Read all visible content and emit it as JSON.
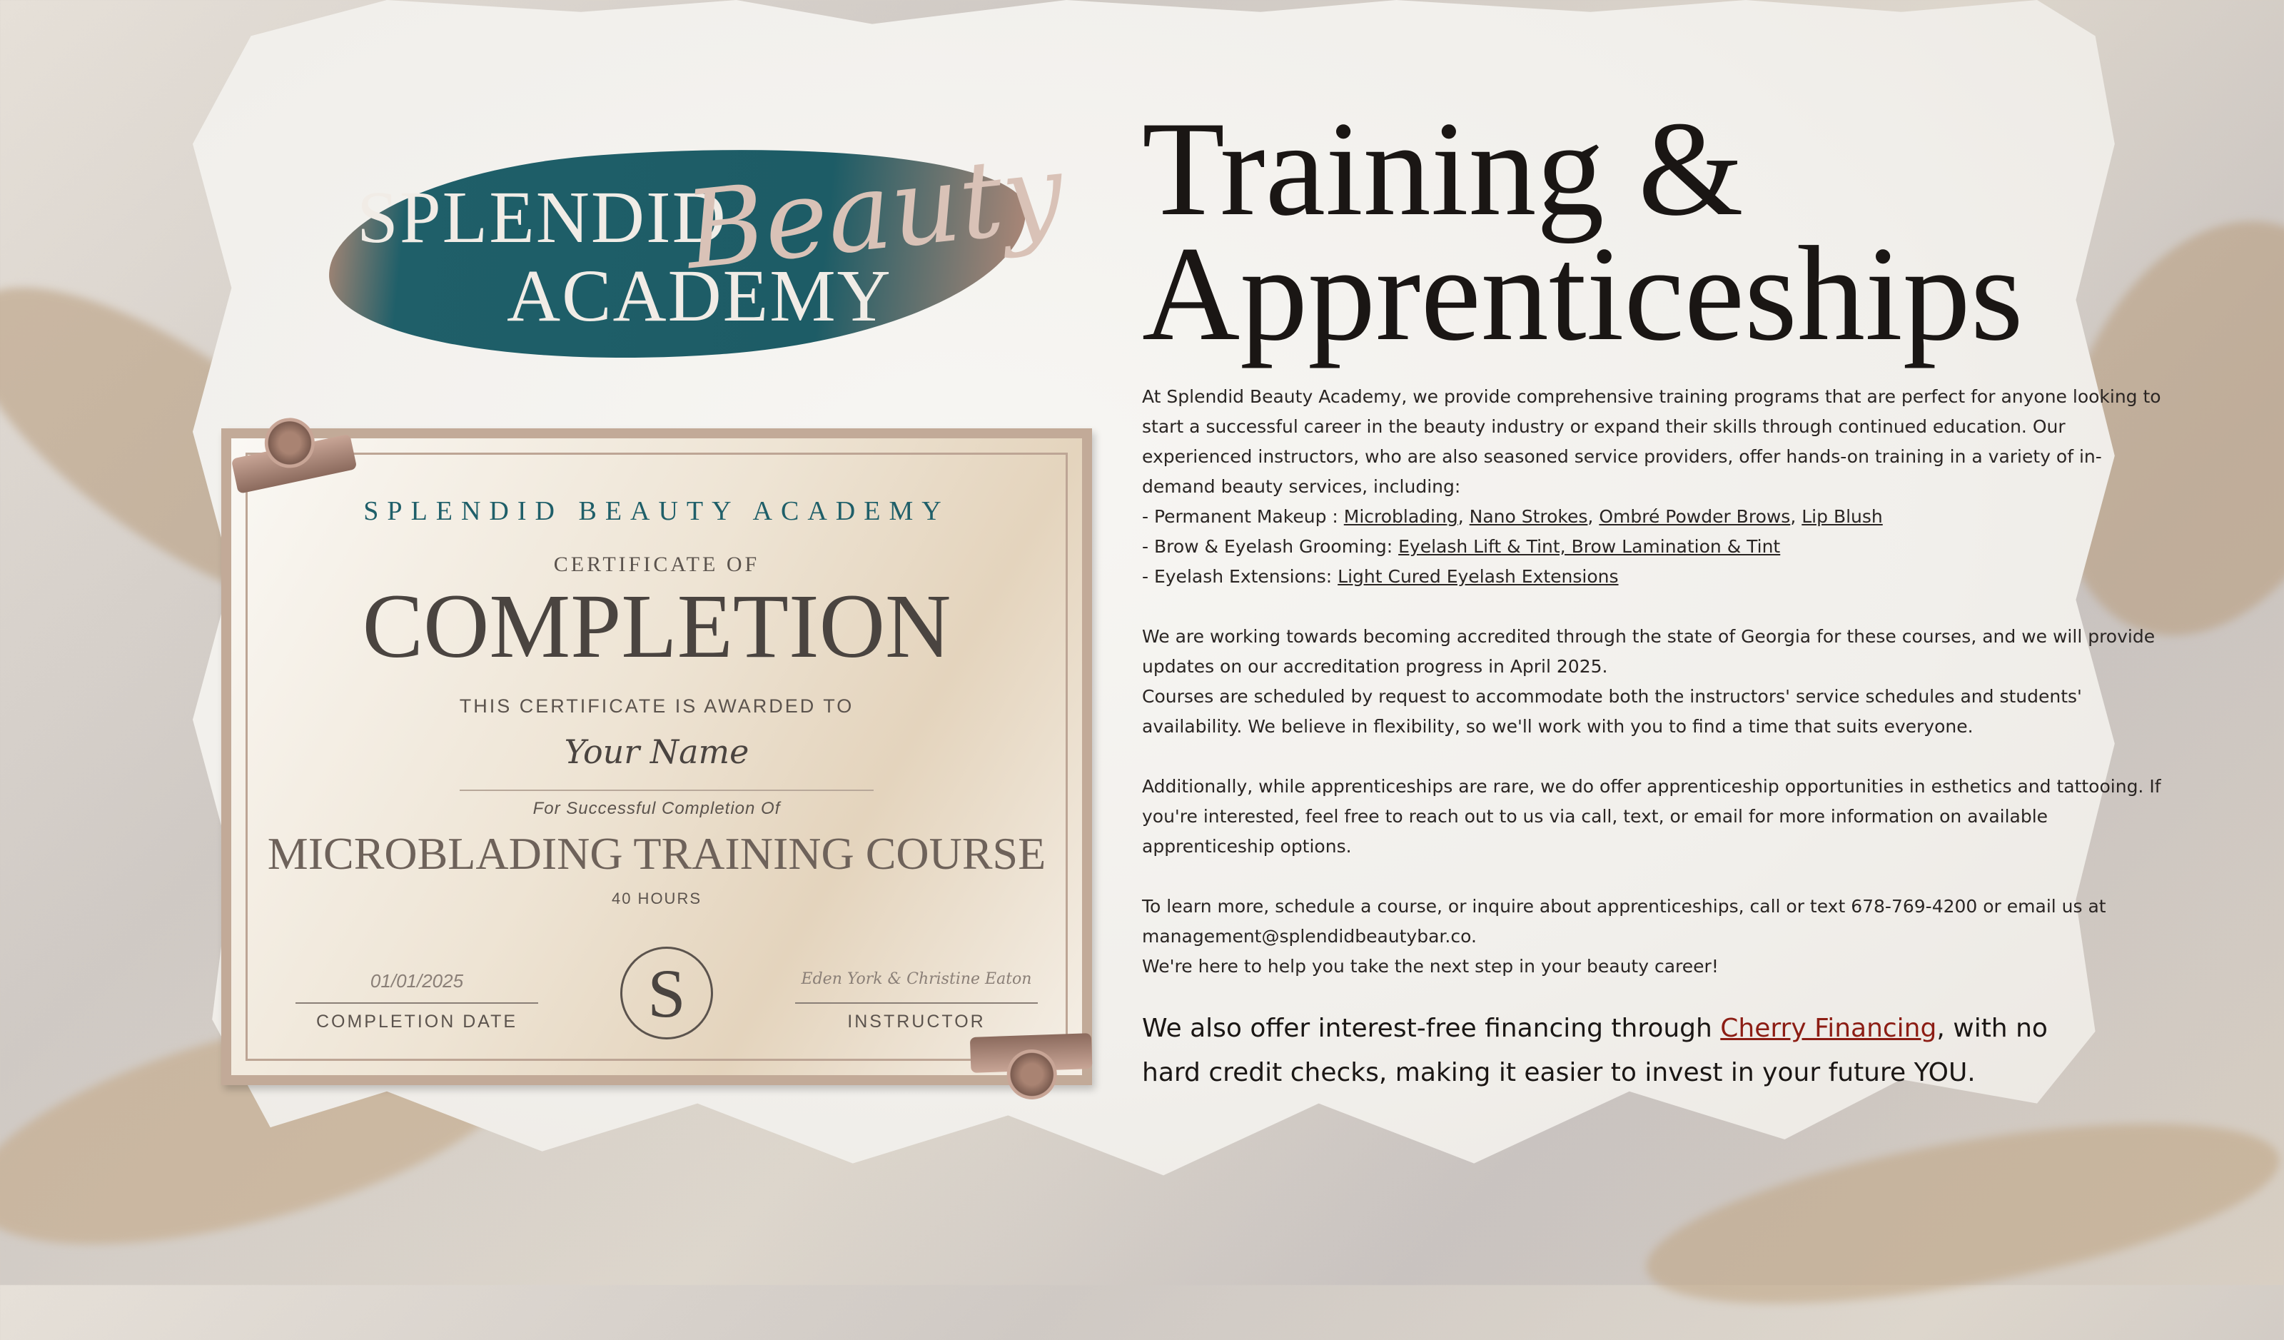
{
  "logo": {
    "line1": "SPLENDID",
    "script": "Beauty",
    "line2": "ACADEMY"
  },
  "certificate": {
    "academy": "SPLENDID BEAUTY ACADEMY",
    "certificate_of": "CERTIFICATE OF",
    "completion": "COMPLETION",
    "awarded_to": "THIS CERTIFICATE IS AWARDED TO",
    "recipient_name": "Your Name",
    "for_completion": "For Successful Completion Of",
    "course": "MICROBLADING TRAINING COURSE",
    "hours": "40 HOURS",
    "date": "01/01/2025",
    "date_label": "COMPLETION DATE",
    "seal_letter": "S",
    "instructors": "Eden York & Christine Eaton",
    "instructor_label": "INSTRUCTOR"
  },
  "heading": {
    "line1": "Training &",
    "line2": "Apprenticeships"
  },
  "body": {
    "intro": "At Splendid Beauty Academy, we provide comprehensive training programs that are perfect for anyone looking to start a successful career in the beauty industry or expand their skills through continued education. Our experienced instructors, who are also seasoned service providers, offer hands-on training in a variety of in-demand beauty services, including:",
    "pmu_prefix": "- Permanent Makeup : ",
    "pmu_links": [
      "Microblading",
      "Nano Strokes",
      "Ombré Powder Brows",
      "Lip Blush"
    ],
    "brow_prefix": "- Brow & Eyelash Grooming: ",
    "brow_link": "Eyelash Lift & Tint, Brow Lamination & Tint",
    "ext_prefix": "- Eyelash Extensions: ",
    "ext_link": "Light Cured Eyelash Extensions",
    "accreditation": "We are working towards becoming accredited through the state of Georgia for these courses, and we will provide updates on our accreditation progress in April 2025.",
    "scheduling": "Courses are scheduled by request to accommodate both the instructors' service schedules and students' availability. We believe in flexibility, so we'll work with you to find a time that suits everyone.",
    "apprenticeship": "Additionally, while apprenticeships are rare, we do offer apprenticeship opportunities in esthetics and tattooing. If you're interested, feel free to reach out to us via call, text, or email for more information on available apprenticeship options.",
    "contact": "To learn more, schedule a course, or inquire about apprenticeships, call or text 678-769-4200 or email us at management@splendidbeautybar.co.",
    "closing": "We're here to help you take the next step in your beauty career!"
  },
  "financing": {
    "before": "We also offer interest-free financing through ",
    "link": "Cherry Financing",
    "after": ", with no hard credit checks, making it easier to invest in your future YOU."
  },
  "colors": {
    "teal": "#1f5f69",
    "rose_gold": "#b98b76",
    "cherry_link": "#8c1d14"
  }
}
